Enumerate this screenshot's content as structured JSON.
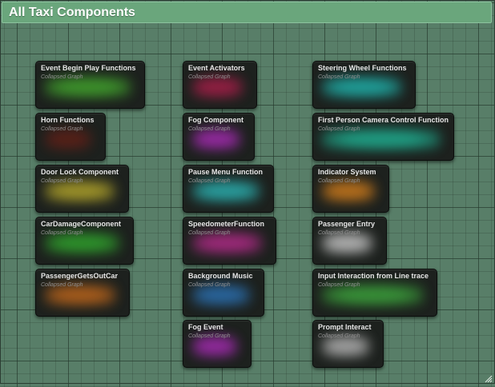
{
  "comment": {
    "title": "All Taxi Components"
  },
  "nodes": [
    {
      "title": "Event Begin Play Functions",
      "subtitle": "Collapsed Graph",
      "color": "#3f9a2c"
    },
    {
      "title": "Horn Functions",
      "subtitle": "Collapsed Graph",
      "color": "#5a2018"
    },
    {
      "title": "Door Lock Component",
      "subtitle": "Collapsed Graph",
      "color": "#a69a2a"
    },
    {
      "title": "CarDamageComponent",
      "subtitle": "Collapsed Graph",
      "color": "#2f9a2c"
    },
    {
      "title": "PassengerGetsOutCar",
      "subtitle": "Collapsed Graph",
      "color": "#b0601c"
    },
    {
      "title": "Event Activators",
      "subtitle": "Collapsed Graph",
      "color": "#9a1f45"
    },
    {
      "title": "Fog Component",
      "subtitle": "Collapsed Graph",
      "color": "#9a2aa6"
    },
    {
      "title": "Pause Menu Function",
      "subtitle": "Collapsed Graph",
      "color": "#2aa6a6"
    },
    {
      "title": "SpeedometerFunction",
      "subtitle": "Collapsed Graph",
      "color": "#a62a80"
    },
    {
      "title": "Background Music",
      "subtitle": "Collapsed Graph",
      "color": "#2a6aa6"
    },
    {
      "title": "Fog Event",
      "subtitle": "Collapsed Graph",
      "color": "#9a2aa6"
    },
    {
      "title": "Steering Wheel Functions",
      "subtitle": "Collapsed Graph",
      "color": "#1fa6a0"
    },
    {
      "title": "First Person Camera Control Function",
      "subtitle": "Collapsed Graph",
      "color": "#1fa68a"
    },
    {
      "title": "Indicator System",
      "subtitle": "Collapsed Graph",
      "color": "#c0741c"
    },
    {
      "title": "Passenger Entry",
      "subtitle": "Collapsed Graph",
      "color": "#b8b8b8"
    },
    {
      "title": "Input Interaction from Line trace",
      "subtitle": "Collapsed Graph",
      "color": "#3a9a3a"
    },
    {
      "title": "Prompt Interact",
      "subtitle": "Collapsed Graph",
      "color": "#a8a8a8"
    }
  ],
  "icons": {
    "resize": "resize-grip-icon"
  }
}
